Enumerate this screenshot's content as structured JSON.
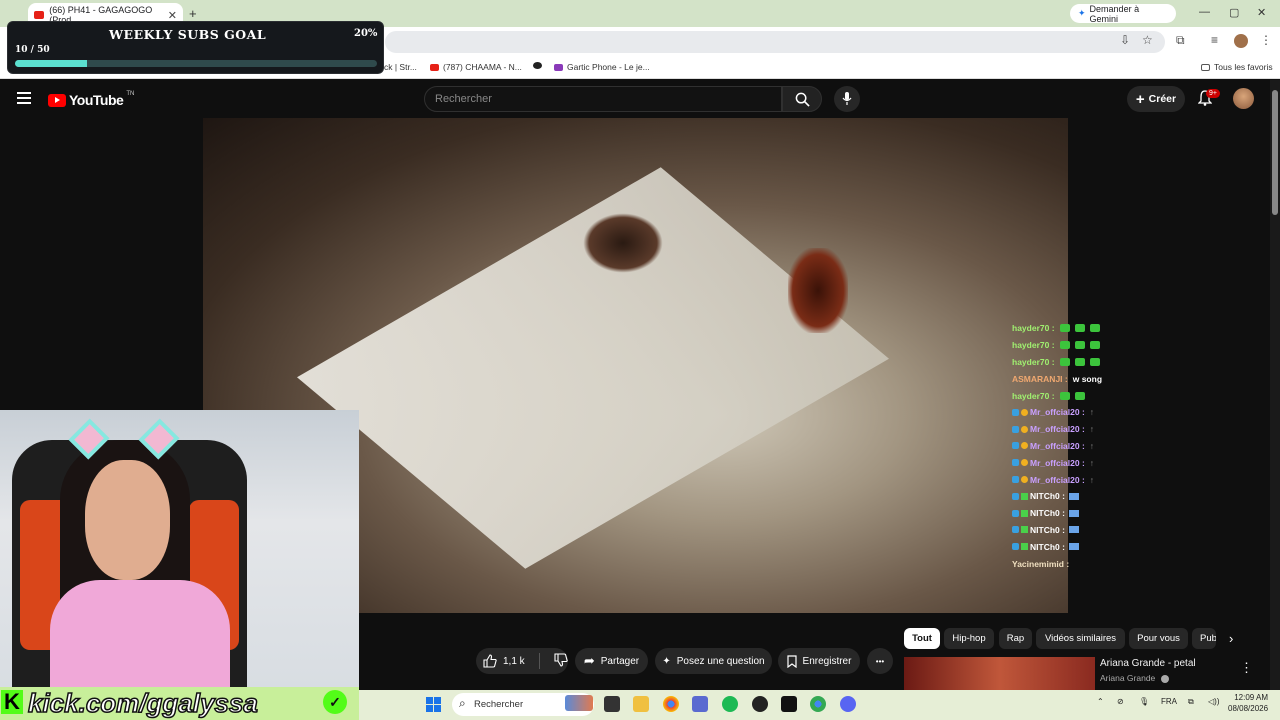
{
  "browser": {
    "tab_title": "(66) PH41 - GAGAGOGO (Prod",
    "new_tab": "+",
    "gemini_label": "Demander à Gemini",
    "window_controls": [
      "—",
      "▢",
      "✕"
    ],
    "bookmarks": [
      {
        "label": "ck | Str...",
        "color": "#333"
      },
      {
        "label": "(787) CHAAMA - N...",
        "color": "#e62117"
      },
      {
        "label": "",
        "color": "#333"
      },
      {
        "label": "Gartic Phone - Le je...",
        "color": "#8a3ab9"
      }
    ],
    "all_favorites": "Tous les favoris"
  },
  "subs_goal": {
    "title": "WEEKLY SUBS GOAL",
    "percent_label": "20%",
    "count_label": "10 / 50",
    "progress": 0.2
  },
  "youtube": {
    "logo_text": "YouTube",
    "logo_suffix": "TN",
    "search_placeholder": "Rechercher",
    "create_label": "Créer",
    "notification_count": "9+"
  },
  "chat": [
    {
      "user": "hayder70 :",
      "style": "u-green",
      "message": "",
      "badges": [],
      "emotes": 3
    },
    {
      "user": "hayder70 :",
      "style": "u-green",
      "message": "",
      "badges": [],
      "emotes": 3
    },
    {
      "user": "hayder70 :",
      "style": "u-green",
      "message": "",
      "badges": [],
      "emotes": 3
    },
    {
      "user": "ASMARANJI :",
      "style": "u-orange",
      "message": "w song",
      "badges": [],
      "emotes": 0
    },
    {
      "user": "hayder70 :",
      "style": "u-green",
      "message": "",
      "badges": [],
      "emotes": 2
    },
    {
      "user": "Mr_offcial20 :",
      "style": "u-purple",
      "message": "",
      "badges": [
        "bl",
        "gd"
      ],
      "emotes": 0,
      "arrow": true
    },
    {
      "user": "Mr_offcial20 :",
      "style": "u-purple",
      "message": "",
      "badges": [
        "bl",
        "gd"
      ],
      "emotes": 0,
      "arrow": true
    },
    {
      "user": "Mr_offcial20 :",
      "style": "u-purple",
      "message": "",
      "badges": [
        "bl",
        "gd"
      ],
      "emotes": 0,
      "arrow": true
    },
    {
      "user": "Mr_offcial20 :",
      "style": "u-purple",
      "message": "",
      "badges": [
        "bl",
        "gd"
      ],
      "emotes": 0,
      "arrow": true
    },
    {
      "user": "Mr_offcial20 :",
      "style": "u-purple",
      "message": "",
      "badges": [
        "bl",
        "gd"
      ],
      "emotes": 0,
      "arrow": true
    },
    {
      "user": "NITCh0 :",
      "style": "u-white",
      "message": "",
      "badges": [
        "bl",
        "gr"
      ],
      "emotes": 0,
      "bird": true
    },
    {
      "user": "NITCh0 :",
      "style": "u-white",
      "message": "",
      "badges": [
        "bl",
        "gr"
      ],
      "emotes": 0,
      "bird": true
    },
    {
      "user": "NITCh0 :",
      "style": "u-white",
      "message": "",
      "badges": [
        "bl",
        "gr"
      ],
      "emotes": 0,
      "bird": true
    },
    {
      "user": "NITCh0 :",
      "style": "u-white",
      "message": "",
      "badges": [
        "bl",
        "gr"
      ],
      "emotes": 0,
      "bird": true
    },
    {
      "user": "Yacinemimid :",
      "style": "u-tan",
      "message": "",
      "badges": [],
      "emotes": 0
    }
  ],
  "actions": {
    "like_count": "1,1 k",
    "share": "Partager",
    "ask": "Posez une question",
    "save": "Enregistrer",
    "more": "•••"
  },
  "chips": [
    {
      "label": "Tout",
      "active": true
    },
    {
      "label": "Hip-hop",
      "active": false
    },
    {
      "label": "Rap",
      "active": false
    },
    {
      "label": "Vidéos similaires",
      "active": false
    },
    {
      "label": "Pour vous",
      "active": false
    },
    {
      "label": "Pub",
      "active": false
    }
  ],
  "recommendation": {
    "title": "Ariana Grande - petal",
    "channel": "Ariana Grande"
  },
  "kick": {
    "text": "kick.com/ggalyssa",
    "k_logo": "K",
    "check": "✓"
  },
  "taskbar": {
    "search_placeholder": "Rechercher",
    "lang": "FRA",
    "time": "12:09 AM",
    "date": "08/08/2026"
  }
}
